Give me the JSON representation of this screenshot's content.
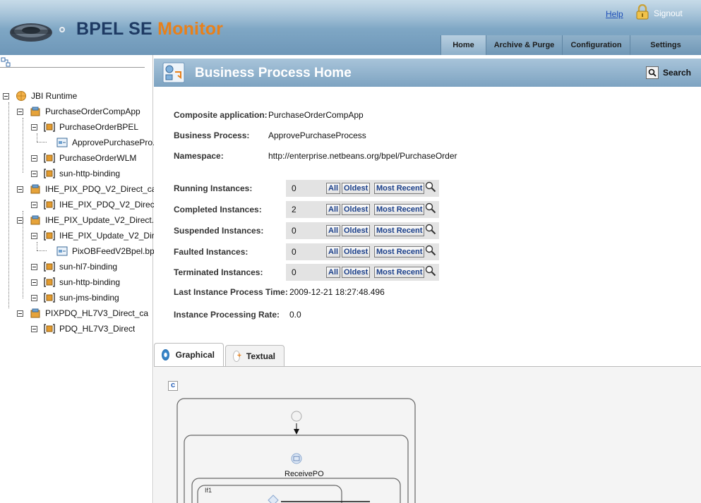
{
  "header": {
    "app_title_main": "BPEL SE ",
    "app_title_accent": "Monitor",
    "help_label": "Help",
    "signout_label": "Signout",
    "tabs": [
      "Home",
      "Archive & Purge",
      "Configuration",
      "Settings"
    ],
    "active_tab": "Home"
  },
  "sidebar": {
    "tree": [
      {
        "label": "JBI Runtime",
        "icon": "globe-icon"
      },
      {
        "label": "PurchaseOrderCompApp",
        "icon": "composite-app-icon"
      },
      {
        "label": "PurchaseOrderBPEL",
        "icon": "service-unit-icon"
      },
      {
        "label": "ApprovePurchasePro...",
        "icon": "process-icon"
      },
      {
        "label": "PurchaseOrderWLM",
        "icon": "service-unit-icon"
      },
      {
        "label": "sun-http-binding",
        "icon": "service-unit-icon"
      },
      {
        "label": "IHE_PIX_PDQ_V2_Direct_ca",
        "icon": "composite-app-icon"
      },
      {
        "label": "IHE_PIX_PDQ_V2_Direct",
        "icon": "service-unit-icon"
      },
      {
        "label": "IHE_PIX_Update_V2_Direct...",
        "icon": "composite-app-icon"
      },
      {
        "label": "IHE_PIX_Update_V2_Dir...",
        "icon": "service-unit-icon"
      },
      {
        "label": "PixOBFeedV2Bpel.bp...",
        "icon": "process-icon"
      },
      {
        "label": "sun-hl7-binding",
        "icon": "service-unit-icon"
      },
      {
        "label": "sun-http-binding",
        "icon": "service-unit-icon"
      },
      {
        "label": "sun-jms-binding",
        "icon": "service-unit-icon"
      },
      {
        "label": "PIXPDQ_HL7V3_Direct_ca",
        "icon": "composite-app-icon"
      },
      {
        "label": "PDQ_HL7V3_Direct",
        "icon": "service-unit-icon"
      }
    ]
  },
  "main": {
    "page_title": "Business Process Home",
    "search_label": "Search",
    "info": {
      "composite_label": "Composite application:",
      "composite_value": "PurchaseOrderCompApp",
      "process_label": "Business Process:",
      "process_value": "ApprovePurchaseProcess",
      "namespace_label": "Namespace:",
      "namespace_value": "http://enterprise.netbeans.org/bpel/PurchaseOrder"
    },
    "instances": [
      {
        "label": "Running Instances:",
        "count": "0"
      },
      {
        "label": "Completed Instances:",
        "count": "2"
      },
      {
        "label": "Suspended Instances:",
        "count": "0"
      },
      {
        "label": "Faulted Instances:",
        "count": "0"
      },
      {
        "label": "Terminated Instances:",
        "count": "0"
      }
    ],
    "buttons": {
      "all": "All",
      "oldest": "Oldest",
      "most_recent": "Most Recent"
    },
    "last_time_label": "Last Instance Process Time:",
    "last_time_value": "2009-12-21 18:27:48.496",
    "rate_label": "Instance Processing Rate:",
    "rate_value": "0.0",
    "view_tabs": [
      "Graphical",
      "Textual"
    ],
    "active_view": "Graphical",
    "refresh_label": "c",
    "diagram": {
      "receive_label": "ReceivePO",
      "if_label": "If1"
    }
  },
  "colors": {
    "header_blue": "#7ea6c4",
    "title_navy": "#1e3a63",
    "title_orange": "#e8801a",
    "link_blue": "#1f4fb8"
  }
}
